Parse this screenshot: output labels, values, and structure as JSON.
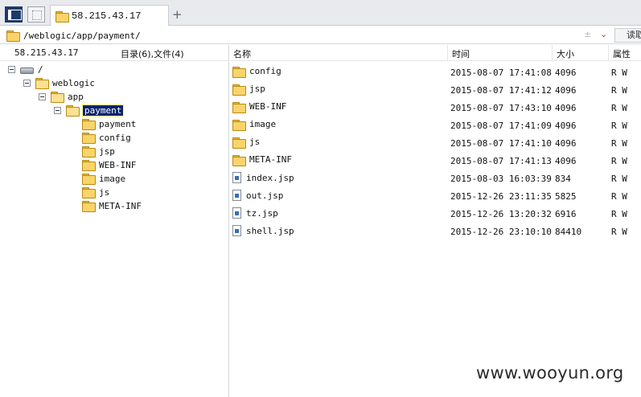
{
  "tab": {
    "title": "58.215.43.17",
    "add_label": "+"
  },
  "address": {
    "path": "/weblogic/app/payment/",
    "controls": "±",
    "caret": "⌄",
    "read_label": "读取"
  },
  "left": {
    "host": "58.215.43.17",
    "counts": "目录(6),文件(4)",
    "tree": {
      "root": "/",
      "weblogic": "weblogic",
      "app": "app",
      "payment": "payment",
      "children": [
        "payment",
        "config",
        "jsp",
        "WEB-INF",
        "image",
        "js",
        "META-INF"
      ]
    }
  },
  "columns": {
    "name": "名称",
    "time": "时间",
    "size": "大小",
    "attr": "属性"
  },
  "files": [
    {
      "name": "config",
      "type": "folder",
      "time": "2015-08-07 17:41:08",
      "size": "4096",
      "attr": "R W"
    },
    {
      "name": "jsp",
      "type": "folder",
      "time": "2015-08-07 17:41:12",
      "size": "4096",
      "attr": "R W"
    },
    {
      "name": "WEB-INF",
      "type": "folder",
      "time": "2015-08-07 17:43:10",
      "size": "4096",
      "attr": "R W"
    },
    {
      "name": "image",
      "type": "folder",
      "time": "2015-08-07 17:41:09",
      "size": "4096",
      "attr": "R W"
    },
    {
      "name": "js",
      "type": "folder",
      "time": "2015-08-07 17:41:10",
      "size": "4096",
      "attr": "R W"
    },
    {
      "name": "META-INF",
      "type": "folder",
      "time": "2015-08-07 17:41:13",
      "size": "4096",
      "attr": "R W"
    },
    {
      "name": "index.jsp",
      "type": "file",
      "time": "2015-08-03 16:03:39",
      "size": "834",
      "attr": "R W"
    },
    {
      "name": "out.jsp",
      "type": "file",
      "time": "2015-12-26 23:11:35",
      "size": "5825",
      "attr": "R W"
    },
    {
      "name": "tz.jsp",
      "type": "file",
      "time": "2015-12-26 13:20:32",
      "size": "6916",
      "attr": "R W"
    },
    {
      "name": "shell.jsp",
      "type": "file",
      "time": "2015-12-26 23:10:10",
      "size": "84410",
      "attr": "R W"
    }
  ],
  "watermark": "www.wooyun.org",
  "colors": {
    "selection": "#0a246a",
    "folder": "#f8d46a",
    "caret": "#c0392b"
  }
}
